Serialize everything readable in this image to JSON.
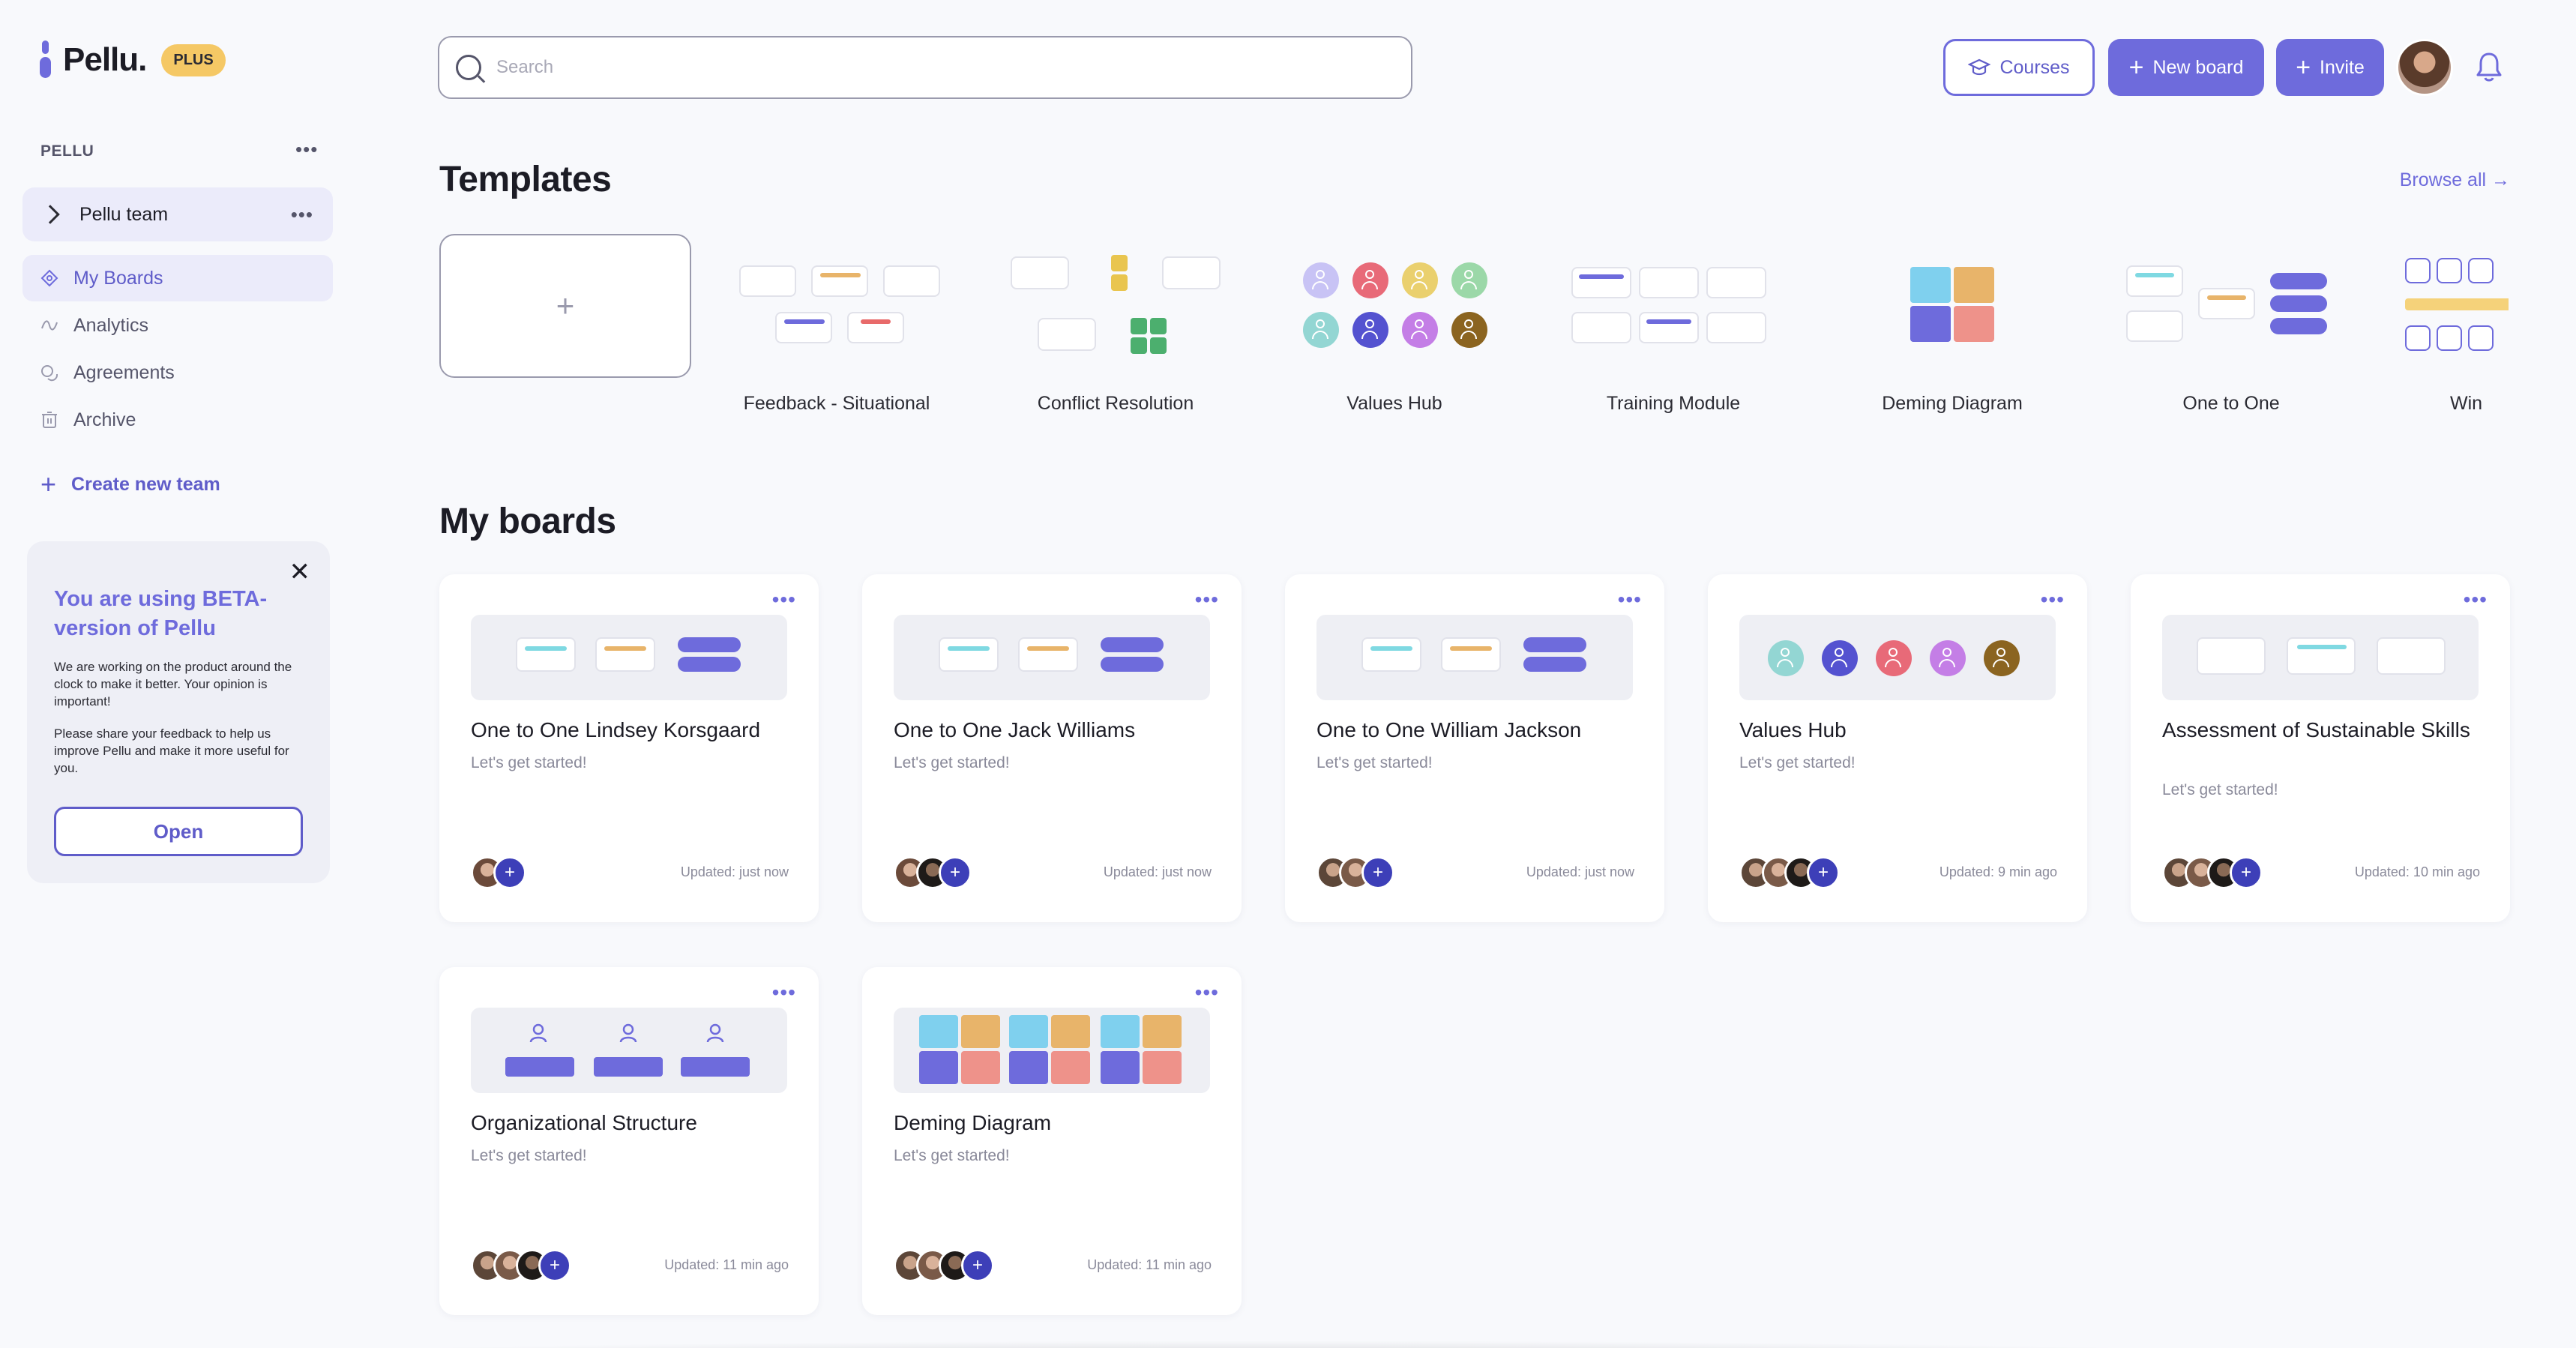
{
  "app": {
    "brand": "Pellu.",
    "plan_badge": "PLUS"
  },
  "sidebar": {
    "workspace_label": "PELLU",
    "team_name": "Pellu team",
    "nav": [
      {
        "label": "My Boards",
        "icon": "boards-icon",
        "active": true
      },
      {
        "label": "Analytics",
        "icon": "analytics-icon",
        "active": false
      },
      {
        "label": "Agreements",
        "icon": "agreements-icon",
        "active": false
      },
      {
        "label": "Archive",
        "icon": "archive-icon",
        "active": false
      }
    ],
    "create_team": "Create new team",
    "beta": {
      "title": "You are using BETA-version of Pellu",
      "text1": "We are working on the product around the clock to make it better. Your opinion is important!",
      "text2": "Please share your feedback to help us improve Pellu and make it more useful for you.",
      "button": "Open"
    }
  },
  "header": {
    "search_placeholder": "Search",
    "courses": "Courses",
    "new_board": "New board",
    "invite": "Invite"
  },
  "templates": {
    "title": "Templates",
    "browse_all": "Browse all →",
    "items": [
      "Feedback - Situational",
      "Conflict Resolution",
      "Values Hub",
      "Training Module",
      "Deming Diagram",
      "One to One",
      "Win"
    ]
  },
  "boards": {
    "title": "My boards",
    "items": [
      {
        "title": "One to One Lindsey Korsgaard",
        "subtitle": "Let's get started!",
        "updated": "Updated: just now"
      },
      {
        "title": "One to One Jack Williams",
        "subtitle": "Let's get started!",
        "updated": "Updated: just now"
      },
      {
        "title": "One to One William Jackson",
        "subtitle": "Let's get started!",
        "updated": "Updated: just now"
      },
      {
        "title": "Values Hub",
        "subtitle": "Let's get started!",
        "updated": "Updated: 9 min ago"
      },
      {
        "title": "Assessment of Sustainable Skills",
        "subtitle": "Let's get started!",
        "updated": "Updated: 10 min ago"
      },
      {
        "title": "Organizational Structure",
        "subtitle": "Let's get started!",
        "updated": "Updated: 11 min ago"
      },
      {
        "title": "Deming Diagram",
        "subtitle": "Let's get started!",
        "updated": "Updated: 11 min ago"
      }
    ]
  },
  "colors": {
    "accent": "#6e6bdc",
    "teal": "#7fd9e2",
    "orange": "#e8b46a",
    "red": "#e86a6a",
    "green": "#4caf6e",
    "yellow": "#e9c54f"
  }
}
